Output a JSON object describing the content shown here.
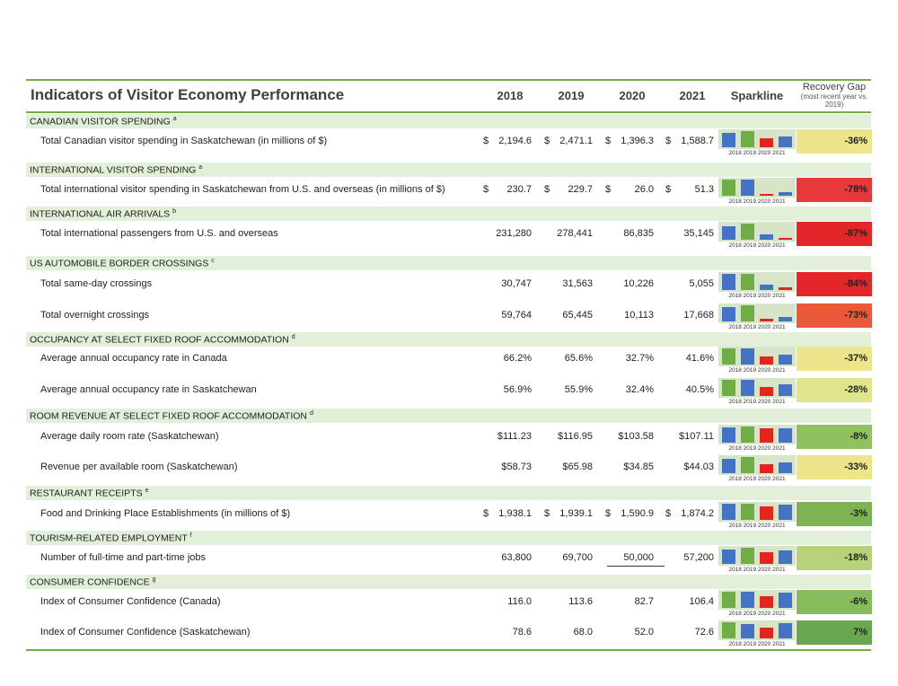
{
  "header": {
    "title": "Indicators of Visitor Economy Performance",
    "years": [
      "2018",
      "2019",
      "2020",
      "2021"
    ],
    "sparkline": "Sparkline",
    "recovery_gap": "Recovery Gap",
    "recovery_gap_note": "(most recent year vs. 2019)"
  },
  "sparkline_years": "2018 2019 2020 2021",
  "colors": {
    "accent_line": "#70ad47",
    "category_bg": "#e2efd9",
    "sparkline_bg": "#d6e5c8",
    "bar_blue": "#4472c4",
    "bar_green": "#70ad47",
    "bar_red": "#e0261f"
  },
  "categories": [
    {
      "label": "CANADIAN VISITOR SPENDING",
      "note": "a",
      "rows": [
        {
          "label": "Total Canadian visitor spending in Saskatchewan (in millions of $)",
          "currency": true,
          "values": [
            "2,194.6",
            "2,471.1",
            "1,396.3",
            "1,588.7"
          ],
          "raw": [
            2194.6,
            2471.1,
            1396.3,
            1588.7
          ],
          "gap": "-36%",
          "gap_color": "#ede58c"
        }
      ]
    },
    {
      "label": "INTERNATIONAL VISITOR SPENDING",
      "note": "a",
      "rows": [
        {
          "label": "Total international visitor spending in Saskatchewan from U.S. and overseas (in millions of $)",
          "currency": true,
          "values": [
            "230.7",
            "229.7",
            "26.0",
            "51.3"
          ],
          "raw": [
            230.7,
            229.7,
            26.0,
            51.3
          ],
          "gap": "-78%",
          "gap_color": "#e8393a"
        }
      ]
    },
    {
      "label": "INTERNATIONAL AIR ARRIVALS",
      "note": "b",
      "rows": [
        {
          "label": "Total international passengers from U.S. and overseas",
          "currency": false,
          "values": [
            "231,280",
            "278,441",
            "86,835",
            "35,145"
          ],
          "raw": [
            231280,
            278441,
            86835,
            35145
          ],
          "gap": "-87%",
          "gap_color": "#e3262a"
        }
      ]
    },
    {
      "label": "US AUTOMOBILE BORDER CROSSINGS",
      "note": "c",
      "rows": [
        {
          "label": "Total same-day crossings",
          "currency": false,
          "values": [
            "30,747",
            "31,563",
            "10,226",
            "5,055"
          ],
          "raw": [
            30747,
            31563,
            10226,
            5055
          ],
          "gap": "-84%",
          "gap_color": "#e3262a"
        },
        {
          "label": "Total overnight crossings",
          "currency": false,
          "values": [
            "59,764",
            "65,445",
            "10,113",
            "17,668"
          ],
          "raw": [
            59764,
            65445,
            10113,
            17668
          ],
          "gap": "-73%",
          "gap_color": "#ea5a3a"
        }
      ]
    },
    {
      "label": "OCCUPANCY AT SELECT FIXED ROOF ACCOMMODATION",
      "note": "d",
      "rows": [
        {
          "label": "Average annual occupancy rate in Canada",
          "currency": false,
          "values": [
            "66.2%",
            "65.6%",
            "32.7%",
            "41.6%"
          ],
          "raw": [
            66.2,
            65.6,
            32.7,
            41.6
          ],
          "gap": "-37%",
          "gap_color": "#ede58c"
        },
        {
          "label": "Average annual occupancy rate in Saskatchewan",
          "currency": false,
          "values": [
            "56.9%",
            "55.9%",
            "32.4%",
            "40.5%"
          ],
          "raw": [
            56.9,
            55.9,
            32.4,
            40.5
          ],
          "gap": "-28%",
          "gap_color": "#dfe58c"
        }
      ]
    },
    {
      "label": "ROOM REVENUE AT SELECT FIXED ROOF ACCOMMODATION",
      "note": "d",
      "rows": [
        {
          "label": "Average daily room rate (Saskatchewan)",
          "currency": false,
          "values": [
            "$111.23",
            "$116.95",
            "$103.58",
            "$107.11"
          ],
          "raw": [
            111.23,
            116.95,
            103.58,
            107.11
          ],
          "gap": "-8%",
          "gap_color": "#8fc160"
        },
        {
          "label": "Revenue per available room (Saskatchewan)",
          "currency": false,
          "values": [
            "$58.73",
            "$65.98",
            "$34.85",
            "$44.03"
          ],
          "raw": [
            58.73,
            65.98,
            34.85,
            44.03
          ],
          "gap": "-33%",
          "gap_color": "#ede58c"
        }
      ]
    },
    {
      "label": "RESTAURANT RECEIPTS",
      "note": "e",
      "rows": [
        {
          "label": "Food and Drinking Place Establishments (in millions of $)",
          "currency": true,
          "values": [
            "1,938.1",
            "1,939.1",
            "1,590.9",
            "1,874.2"
          ],
          "raw": [
            1938.1,
            1939.1,
            1590.9,
            1874.2
          ],
          "gap": "-3%",
          "gap_color": "#7db352"
        }
      ]
    },
    {
      "label": "TOURISM-RELATED EMPLOYMENT",
      "note": "f",
      "rows": [
        {
          "label": "Number of full-time and part-time jobs",
          "currency": false,
          "values": [
            "63,800",
            "69,700",
            "50,000",
            "57,200"
          ],
          "raw": [
            63800,
            69700,
            50000,
            57200
          ],
          "gap": "-18%",
          "gap_color": "#b7d27a",
          "underline_2020": true
        }
      ]
    },
    {
      "label": "CONSUMER CONFIDENCE",
      "note": "g",
      "rows": [
        {
          "label": "Index of Consumer Confidence (Canada)",
          "currency": false,
          "values": [
            "116.0",
            "113.6",
            "82.7",
            "106.4"
          ],
          "raw": [
            116.0,
            113.6,
            82.7,
            106.4
          ],
          "gap": "-6%",
          "gap_color": "#87bc5b"
        },
        {
          "label": "Index of Consumer Confidence (Saskatchewan)",
          "currency": false,
          "values": [
            "78.6",
            "68.0",
            "52.0",
            "72.6"
          ],
          "raw": [
            78.6,
            68.0,
            52.0,
            72.6
          ],
          "gap": "7%",
          "gap_color": "#6aa84f"
        }
      ]
    }
  ]
}
